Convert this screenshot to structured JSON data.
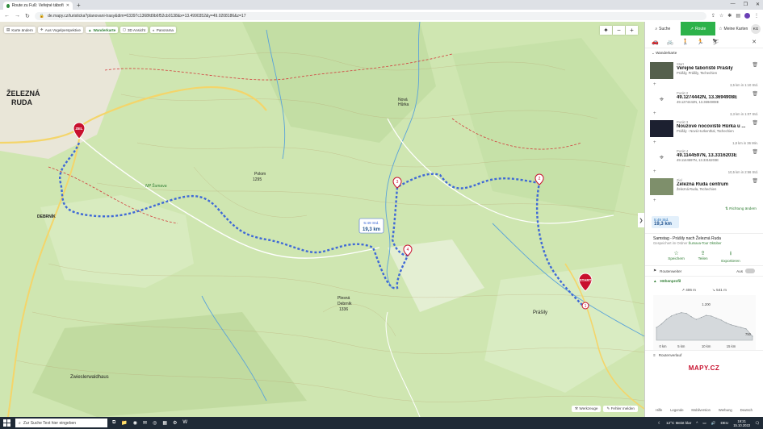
{
  "browser": {
    "tab_title": "Route zu Fuß: Veřejné tábořiště Prášily",
    "url": "de.mapy.cz/turisticka?planovani-trasy&dim=63397c1368fd9b6f52cb0138&x=13.4990352&y=49.0208186&z=17"
  },
  "map": {
    "layers": [
      {
        "label": "Karte ändern",
        "icon": "layers-icon",
        "active": false
      },
      {
        "label": "Aus Vogelperspektive",
        "icon": "bird-icon",
        "active": false
      },
      {
        "label": "Wanderkarte",
        "icon": "mountain-icon",
        "active": true
      },
      {
        "label": "3D Ansicht",
        "icon": "cube-icon",
        "active": false
      },
      {
        "label": "Panorama",
        "icon": "panorama-icon",
        "active": false
      }
    ],
    "zoom_minus": "−",
    "zoom_plus": "+",
    "route_label_time": "5:49 Std.",
    "route_label_dist": "19,3 km",
    "places": [
      {
        "name": "ŽELEZNÁ",
        "cls": "town"
      },
      {
        "name": "RUDA",
        "cls": "town"
      },
      {
        "name": "DEBRNÍK",
        "cls": "vil"
      },
      {
        "name": "Zwieslerwaldhaus",
        "cls": "vil"
      },
      {
        "name": "Nová",
        "cls": "small"
      },
      {
        "name": "Hůrka",
        "cls": "small"
      },
      {
        "name": "Prášily",
        "cls": "vil"
      },
      {
        "name": "Polom",
        "cls": "small"
      },
      {
        "name": "1295",
        "cls": "small"
      },
      {
        "name": "NP Šumava",
        "cls": "np"
      },
      {
        "name": "Plesná",
        "cls": "small"
      },
      {
        "name": "Debrník",
        "cls": "small"
      },
      {
        "name": "1336",
        "cls": "small"
      }
    ],
    "markers": {
      "start": "START",
      "end": "ZIEL",
      "waypoints": [
        "1",
        "2",
        "3",
        "4"
      ]
    },
    "footer": [
      {
        "label": "Werkzeuge",
        "icon": "tools-icon"
      },
      {
        "label": "Fehler melden",
        "icon": "pencil-icon"
      }
    ]
  },
  "panel": {
    "tabs": [
      {
        "label": "Suche",
        "icon": "search-icon",
        "active": false
      },
      {
        "label": "Route",
        "icon": "route-icon",
        "active": true
      },
      {
        "label": "Meine Karten",
        "icon": "star-icon",
        "active": false
      }
    ],
    "user_initials": "KG",
    "route_type": "Wanderkarte",
    "stops": [
      {
        "label": "Start",
        "name": "Veřejné tábořiště Prášily",
        "sub": "Prášily, Prášily, Tschechien",
        "thumb": "photo",
        "seg": "3,5 km in 1:10 Std."
      },
      {
        "label": "Punkt 2",
        "name": "49.1274442N, 13.3694908E",
        "sub": "49.1274442N, 13.3694908E",
        "thumb": "pin",
        "seg": "3,3 km in 1:07 Std."
      },
      {
        "label": "Punkt 3",
        "name": "Nouzové nocoviště Hůrka u ...",
        "sub": "Prášily - Nová Hurkenthal, Tschechien",
        "thumb": "dark",
        "seg": "1,8 km in 36 Min."
      },
      {
        "label": "Punkt 4",
        "name": "49.1144597N, 13.3316203E",
        "sub": "49.1144597N, 13.3316203E",
        "thumb": "pin",
        "seg": "10,5 km in 2:56 Std."
      },
      {
        "label": "Ziel",
        "name": "Železná Ruda centrum",
        "sub": "Železná Ruda, Tschechien",
        "thumb": "town",
        "seg": ""
      }
    ],
    "change_direction": "Richtung ändern",
    "summary_time": "5:49 Std.",
    "summary_dist": "19,3 km",
    "saved_title": "Samstag - Prášily nach Železná Ruda",
    "saved_meta_prefix": "Gespeichert im Ordner",
    "saved_meta_folder": "Šumava-Tour Oktober",
    "actions": [
      {
        "label": "Speichern",
        "icon": "star-icon"
      },
      {
        "label": "Teilen",
        "icon": "share-icon"
      },
      {
        "label": "Exportieren",
        "icon": "download-icon"
      }
    ],
    "route_further": "Routenweiter",
    "toggle_label": "Aus",
    "elevation_title": "Höhenprofil",
    "elev_up": "406 m",
    "elev_down": "541 m",
    "route_detail": "Routenverlauf",
    "brand": "MAPY.CZ",
    "footer": [
      "Hilfe",
      "Legende",
      "Mobilversion",
      "Werbung",
      "Deutsch"
    ]
  },
  "chart_data": {
    "type": "area",
    "title": "Höhenprofil",
    "x": [
      0,
      1,
      2,
      3,
      4,
      5,
      6,
      7,
      8,
      9,
      10,
      11,
      12,
      13,
      14,
      15,
      16,
      17,
      18,
      19.3
    ],
    "y": [
      890,
      940,
      1010,
      1060,
      1090,
      1110,
      1100,
      1050,
      1010,
      1040,
      1070,
      1060,
      1030,
      1000,
      960,
      930,
      910,
      890,
      870,
      760
    ],
    "x_ticks": [
      "0 km",
      "5 km",
      "10 km",
      "15 km"
    ],
    "y_ticks": [
      "1.200",
      "750"
    ],
    "xlim": [
      0,
      19.3
    ],
    "ylim": [
      700,
      1250
    ]
  },
  "taskbar": {
    "search_placeholder": "Zur Suche Text hier eingeben",
    "weather": "12°C Meist klar",
    "lang": "DEU",
    "time": "19:21",
    "date": "15.10.2022"
  }
}
